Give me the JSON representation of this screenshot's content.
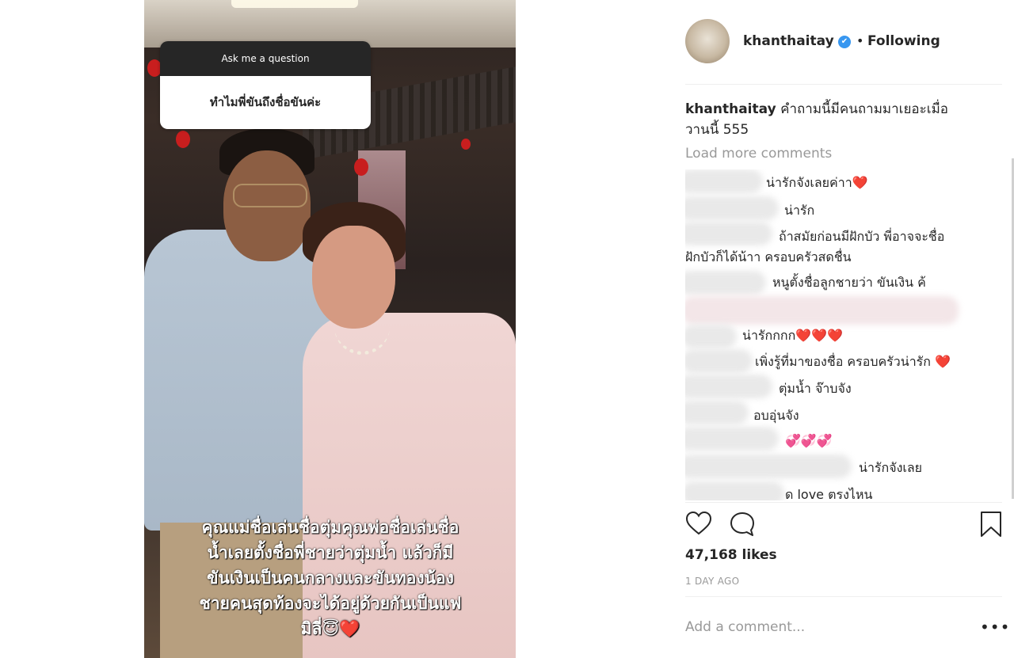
{
  "story": {
    "question_header": "Ask me a question",
    "question_text": "ทำไมพี่ขันถึงชื่อขันค่ะ",
    "overlay_lines": [
      "คุณแม่ชื่อเล่นชื่อตุ่มคุณพ่อชื่อเล่นชื่อ",
      "น้ำเลยตั้งชื่อพี่ชายว่าตุ่มน้ำ  แล้วก็มี",
      "ขันเงินเป็นคนกลางและขันทองน้อง",
      "ชายคนสุดท้องจะได้อยู่ด้วยกันเป็นแฟ",
      "มิลี่😇❤️"
    ]
  },
  "post": {
    "username": "khanthaitay",
    "verified_icon": "✔",
    "separator": "•",
    "follow_status": "Following",
    "caption_user": "khanthaitay",
    "caption_text": " คำถามนี้มีคนถามมาเยอะเมื่อวานนี้ 555",
    "load_more": "Load more comments",
    "comments": [
      "น่ารักจังเลยค่าา❤️",
      "น่ารัก",
      "ถ้าสมัยก่อนมีฝักบัว พี่อาจจะชื่อ",
      "ฝักบัวก็ได้น้าา ครอบครัวสดชื่น",
      "หนูตั้งชื่อลูกชายว่า ขันเงิน ค้",
      "น่ารักกกก❤️❤️❤️",
      "เพิ่งรู้ที่มาของชื่อ ครอบครัวน่ารัก ❤️",
      "ตุ่มน้ำ จ๊าบจัง",
      "อบอุ่นจัง",
      "💞💞💞",
      "น่ารักจังเลย",
      "ด love ตรงไหน"
    ],
    "likes": "47,168 likes",
    "time_ago": "1 DAY AGO",
    "add_comment_placeholder": "Add a comment...",
    "more_options": "•••"
  },
  "icons": {
    "heart": "heart-icon",
    "comment": "comment-icon",
    "bookmark": "bookmark-icon"
  }
}
